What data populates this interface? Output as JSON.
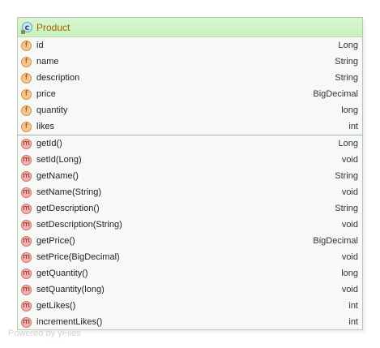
{
  "class_node": {
    "title": "Product",
    "icon": "class-icon",
    "fields": [
      {
        "name": "id",
        "type": "Long",
        "icon": "field-icon"
      },
      {
        "name": "name",
        "type": "String",
        "icon": "field-icon"
      },
      {
        "name": "description",
        "type": "String",
        "icon": "field-icon"
      },
      {
        "name": "price",
        "type": "BigDecimal",
        "icon": "field-icon"
      },
      {
        "name": "quantity",
        "type": "long",
        "icon": "field-icon"
      },
      {
        "name": "likes",
        "type": "int",
        "icon": "field-icon"
      }
    ],
    "methods": [
      {
        "name": "getId()",
        "type": "Long",
        "icon": "method-icon"
      },
      {
        "name": "setId(Long)",
        "type": "void",
        "icon": "method-icon"
      },
      {
        "name": "getName()",
        "type": "String",
        "icon": "method-icon"
      },
      {
        "name": "setName(String)",
        "type": "void",
        "icon": "method-icon"
      },
      {
        "name": "getDescription()",
        "type": "String",
        "icon": "method-icon"
      },
      {
        "name": "setDescription(String)",
        "type": "void",
        "icon": "method-icon"
      },
      {
        "name": "getPrice()",
        "type": "BigDecimal",
        "icon": "method-icon"
      },
      {
        "name": "setPrice(BigDecimal)",
        "type": "void",
        "icon": "method-icon"
      },
      {
        "name": "getQuantity()",
        "type": "long",
        "icon": "method-icon"
      },
      {
        "name": "setQuantity(long)",
        "type": "void",
        "icon": "method-icon"
      },
      {
        "name": "getLikes()",
        "type": "int",
        "icon": "method-icon"
      },
      {
        "name": "incrementLikes()",
        "type": "int",
        "icon": "method-icon"
      }
    ]
  },
  "icons": {
    "class_letter": "c",
    "field_letter": "f",
    "method_letter": "m"
  },
  "watermark": "Powered by yFiles",
  "colors": {
    "header_green": "#c7f1bd",
    "field_orange": "#f2c68d",
    "method_red": "#f3b1ad",
    "title_orange": "#a46200"
  }
}
